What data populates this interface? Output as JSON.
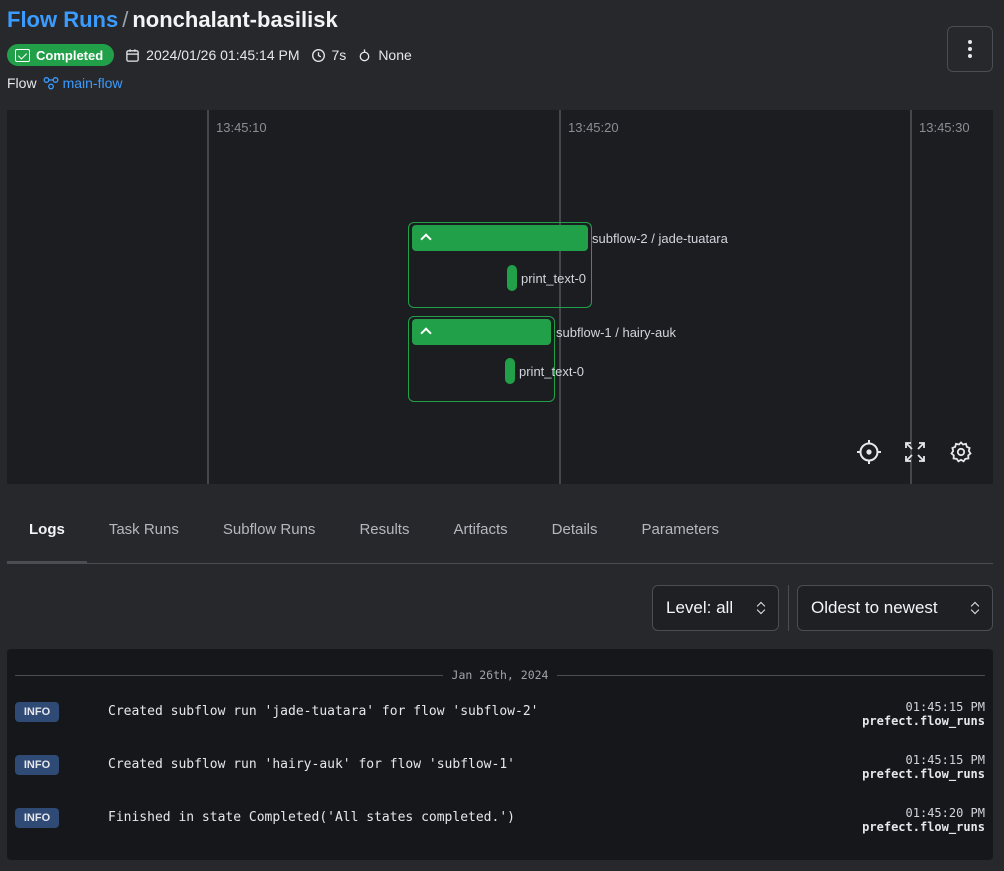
{
  "header": {
    "breadcrumb": "Flow Runs",
    "separator": "/",
    "run_name": "nonchalant-basilisk",
    "state": "Completed",
    "start_time": "2024/01/26 01:45:14 PM",
    "duration": "7s",
    "tags": "None",
    "flow_label": "Flow",
    "flow_name": "main-flow"
  },
  "timeline": {
    "ticks": [
      "13:45:10",
      "13:45:20",
      "13:45:30"
    ],
    "nodes": [
      {
        "label": "subflow-2 / jade-tuatara",
        "task": "print_text-0"
      },
      {
        "label": "subflow-1 / hairy-auk",
        "task": "print_text-0"
      }
    ],
    "state_color": "#22a049"
  },
  "tabs": [
    "Logs",
    "Task Runs",
    "Subflow Runs",
    "Results",
    "Artifacts",
    "Details",
    "Parameters"
  ],
  "active_tab": "Logs",
  "filters": {
    "level": "Level: all",
    "sort": "Oldest to newest"
  },
  "logs": {
    "date": "Jan 26th, 2024",
    "entries": [
      {
        "level": "INFO",
        "message": "Created subflow run 'jade-tuatara' for flow 'subflow-2'",
        "time": "01:45:15 PM",
        "source": "prefect.flow_runs"
      },
      {
        "level": "INFO",
        "message": "Created subflow run 'hairy-auk' for flow 'subflow-1'",
        "time": "01:45:15 PM",
        "source": "prefect.flow_runs"
      },
      {
        "level": "INFO",
        "message": "Finished in state Completed('All states completed.')",
        "time": "01:45:20 PM",
        "source": "prefect.flow_runs"
      }
    ]
  },
  "icons": {
    "state": "check-square-icon",
    "calendar": "calendar-icon",
    "duration": "clock-icon",
    "tags": "tag-icon",
    "flow": "flow-icon",
    "recenter": "crosshair-icon",
    "fullscreen": "expand-icon",
    "settings": "gear-icon",
    "menu": "kebab-menu-icon"
  }
}
